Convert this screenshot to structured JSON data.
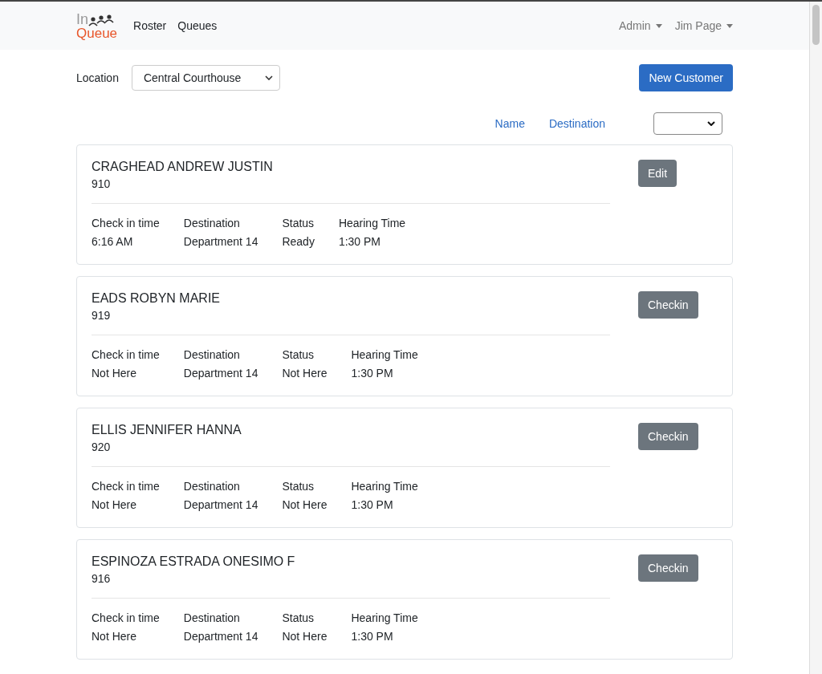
{
  "navbar": {
    "logo": {
      "top": "In",
      "bottom": "Queue"
    },
    "links": [
      "Roster",
      "Queues"
    ],
    "menus": [
      "Admin",
      "Jim Page"
    ]
  },
  "toolbar": {
    "location_label": "Location",
    "location_value": "Central Courthouse",
    "new_button": "New Customer"
  },
  "sort": {
    "links": [
      "Name",
      "Destination"
    ]
  },
  "customers": [
    {
      "name": "CRAGHEAD ANDREW JUSTIN",
      "number": "910",
      "action": "Edit",
      "fields": [
        {
          "label": "Check in time",
          "value": "6:16 AM"
        },
        {
          "label": "Destination",
          "value": "Department 14"
        },
        {
          "label": "Status",
          "value": "Ready"
        },
        {
          "label": "Hearing Time",
          "value": "1:30 PM"
        }
      ]
    },
    {
      "name": "EADS ROBYN MARIE",
      "number": "919",
      "action": "Checkin",
      "fields": [
        {
          "label": "Check in time",
          "value": "Not Here"
        },
        {
          "label": "Destination",
          "value": "Department 14"
        },
        {
          "label": "Status",
          "value": "Not Here"
        },
        {
          "label": "Hearing Time",
          "value": "1:30 PM"
        }
      ]
    },
    {
      "name": "ELLIS JENNIFER HANNA",
      "number": "920",
      "action": "Checkin",
      "fields": [
        {
          "label": "Check in time",
          "value": "Not Here"
        },
        {
          "label": "Destination",
          "value": "Department 14"
        },
        {
          "label": "Status",
          "value": "Not Here"
        },
        {
          "label": "Hearing Time",
          "value": "1:30 PM"
        }
      ]
    },
    {
      "name": "ESPINOZA ESTRADA ONESIMO F",
      "number": "916",
      "action": "Checkin",
      "fields": [
        {
          "label": "Check in time",
          "value": "Not Here"
        },
        {
          "label": "Destination",
          "value": "Department 14"
        },
        {
          "label": "Status",
          "value": "Not Here"
        },
        {
          "label": "Hearing Time",
          "value": "1:30 PM"
        }
      ]
    }
  ]
}
